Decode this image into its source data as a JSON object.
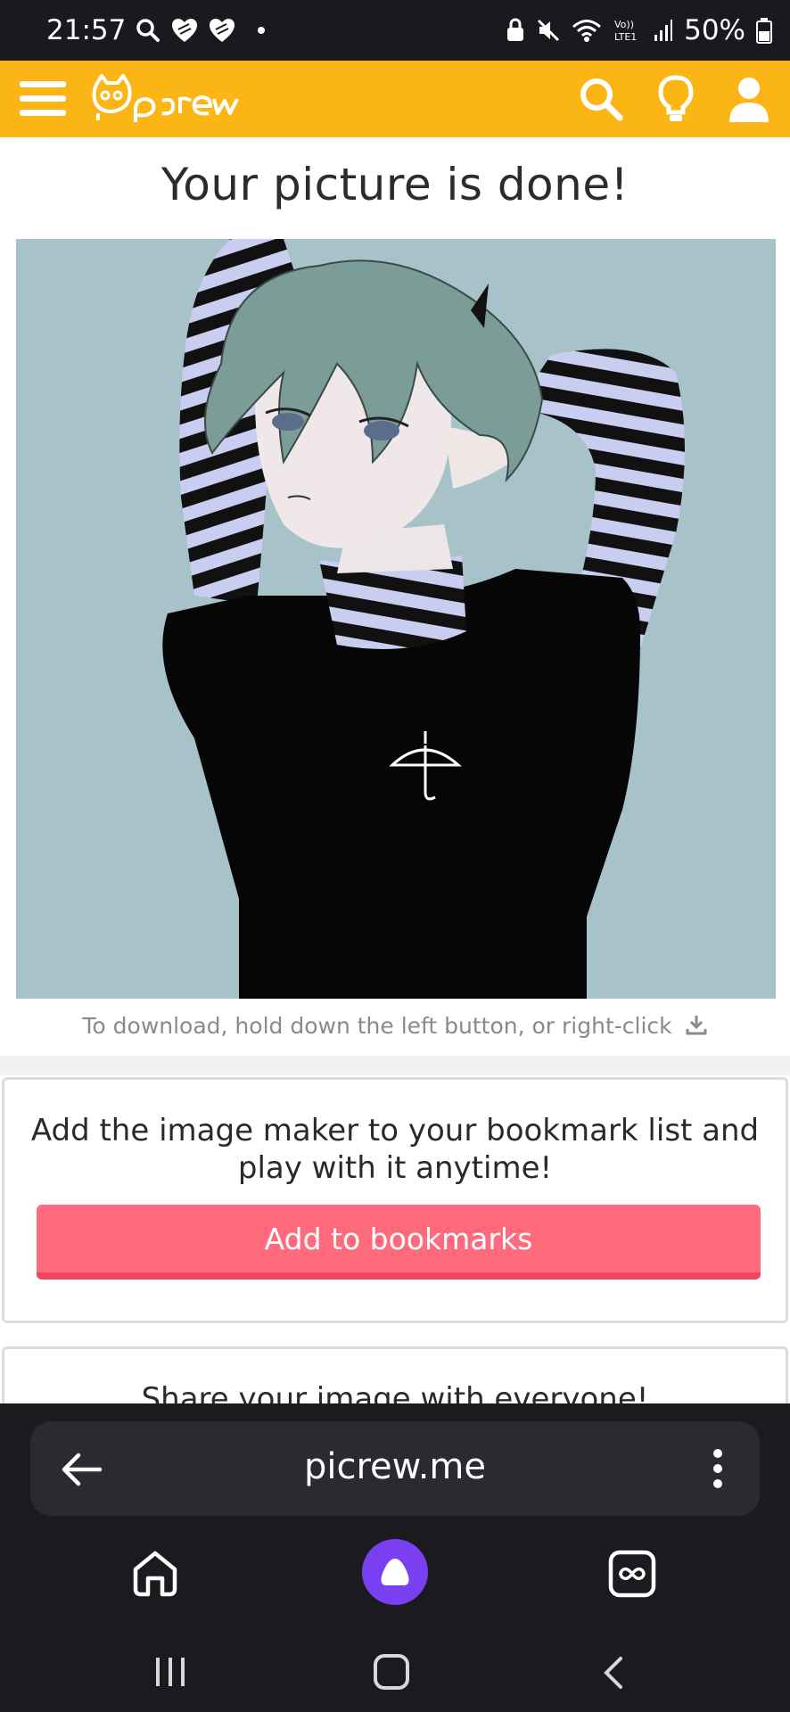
{
  "status_bar": {
    "time": "21:57",
    "battery": "50%",
    "icons": [
      "search-icon",
      "heart-icon",
      "heart-icon",
      "notification-dot",
      "lock-icon",
      "mute-icon",
      "wifi-icon",
      "volte-icon",
      "signal-icon",
      "battery-icon"
    ],
    "volte_label": "Vo)) LTE1"
  },
  "header": {
    "brand": "Picrew",
    "background_color": "#fbb616",
    "icons": [
      "menu-icon",
      "search-icon",
      "lightbulb-icon",
      "user-icon"
    ]
  },
  "page": {
    "title": "Your picture is done!",
    "download_hint": "To download, hold down the left button, or right-click",
    "download_icon": "download-icon"
  },
  "bookmark_card": {
    "text": "Add the image maker to your bookmark list and play with it anytime!",
    "button_label": "Add to bookmarks",
    "button_color": "#ff6b7d"
  },
  "share_card": {
    "text": "Share your image with everyone!"
  },
  "browser": {
    "url": "picrew.me",
    "icons": [
      "back-arrow-icon",
      "more-vert-icon",
      "home-icon",
      "alice-icon",
      "tabs-icon"
    ]
  },
  "system_nav": {
    "icons": [
      "recent-apps-icon",
      "home-button-icon",
      "back-icon"
    ]
  }
}
